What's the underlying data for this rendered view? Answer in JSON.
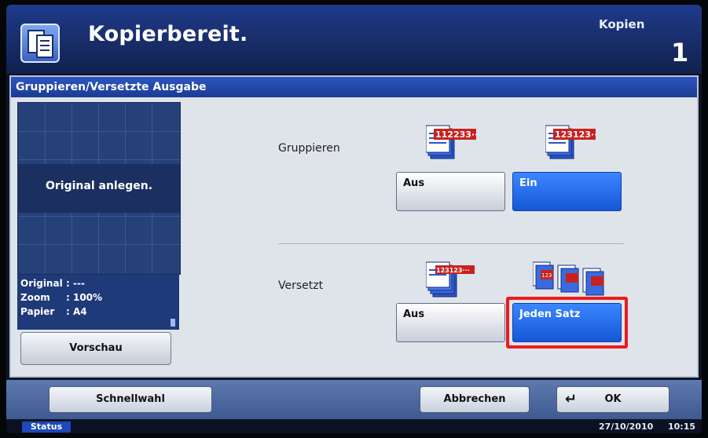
{
  "header": {
    "title": "Kopierbereit.",
    "copies_label": "Kopien",
    "copies_count": "1"
  },
  "panel": {
    "title": "Gruppieren/Versetzte Ausgabe",
    "preview_message": "Original anlegen.",
    "info": [
      {
        "key": "Original",
        "value": ": ---"
      },
      {
        "key": "Zoom",
        "value": ": 100%"
      },
      {
        "key": "Papier",
        "value": ": A4"
      }
    ],
    "preview_button": "Vorschau"
  },
  "settings": {
    "group": {
      "label": "Gruppieren",
      "icon_off_text": "112233···",
      "icon_on_text": "123123···",
      "off_label": "Aus",
      "on_label": "Ein",
      "selected": "Ein"
    },
    "offset": {
      "label": "Versetzt",
      "icon_off_text": "123123···",
      "icon_on_text": "123",
      "off_label": "Aus",
      "on_label": "Jeden Satz",
      "selected": "Jeden Satz"
    }
  },
  "footer": {
    "quick_button": "Schnellwahl",
    "cancel_button": "Abbrechen",
    "ok_button": "OK",
    "ok_icon": "enter-arrow-icon",
    "status_button": "Status",
    "date": "27/10/2010",
    "time": "10:15"
  },
  "colors": {
    "accent": "#1657d6",
    "highlight": "#ec1b1b",
    "header": "#1d3a8a"
  }
}
